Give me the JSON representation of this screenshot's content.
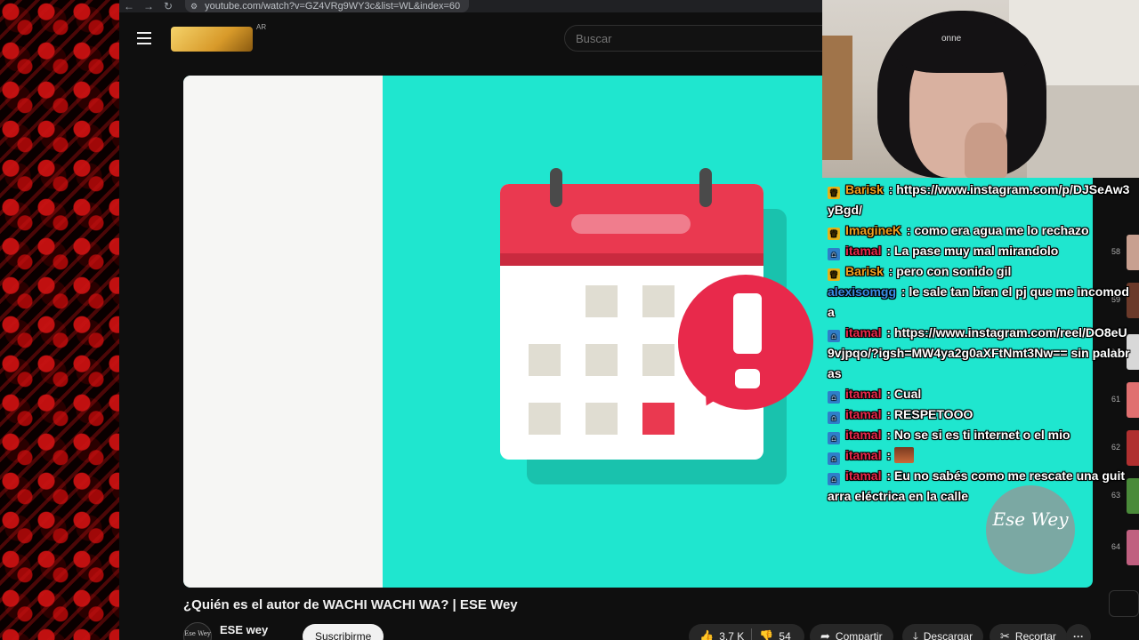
{
  "browser": {
    "back_icon": "arrow-left-icon",
    "forward_icon": "arrow-right-icon",
    "reload_icon": "reload-icon",
    "url": "youtube.com/watch?v=GZ4VRg9WY3c&list=WL&index=60"
  },
  "youtube": {
    "country_code": "AR",
    "search_placeholder": "Buscar"
  },
  "video": {
    "title": "¿Quién es el autor de WACHI WACHI WA? | ESE Wey",
    "channel": "ESE wey",
    "channel_avatar_text": "Ese Wey",
    "subscribe_label": "Suscribirme",
    "likes": "3,7 K",
    "dislikes": "54",
    "share_label": "Compartir",
    "download_label": "Descargar",
    "clip_label": "Recortar",
    "more_label": "···",
    "colors": {
      "background": "#1fe6cf",
      "calendar_red": "#ea3950",
      "alert_red": "#e8294b"
    }
  },
  "playlist": {
    "numbers": [
      "58",
      "59",
      "",
      "61",
      "62",
      "63",
      "64"
    ]
  },
  "webcam": {
    "brand_text": "onne"
  },
  "chat": {
    "messages": [
      {
        "badge": "crown",
        "user": "Barisk",
        "user_color": "#f0a020",
        "text": "https://www.instagram.com/p/DJSeAw3yBgd/",
        "emote": false
      },
      {
        "badge": "crown",
        "user": "ImagineK",
        "user_color": "#f0a020",
        "text": "como era agua me lo rechazo",
        "emote": false
      },
      {
        "badge": "prime",
        "user": "itamal",
        "user_color": "#e8294b",
        "text": "La pase muy mal mirandolo",
        "emote": false
      },
      {
        "badge": "crown",
        "user": "Barisk",
        "user_color": "#f0a020",
        "text": "pero con sonido gil",
        "emote": false
      },
      {
        "badge": "",
        "user": "alexisomgg",
        "user_color": "#3a8ee6",
        "text": "le sale tan bien el pj que me incomoda",
        "emote": false
      },
      {
        "badge": "prime",
        "user": "itamal",
        "user_color": "#e8294b",
        "text": "https://www.instagram.com/reel/DO8eU9vjpqo/?igsh=MW4ya2g0aXFtNmt3Nw== sin palabras",
        "emote": false
      },
      {
        "badge": "prime",
        "user": "itamal",
        "user_color": "#e8294b",
        "text": "Cual",
        "emote": false
      },
      {
        "badge": "prime",
        "user": "itamal",
        "user_color": "#e8294b",
        "text": "RESPETOOO",
        "emote": false
      },
      {
        "badge": "prime",
        "user": "itamal",
        "user_color": "#e8294b",
        "text": "No se si es ti internet o el mio",
        "emote": false
      },
      {
        "badge": "prime",
        "user": "itamal",
        "user_color": "#e8294b",
        "text": "",
        "emote": true
      },
      {
        "badge": "prime",
        "user": "itamal",
        "user_color": "#e8294b",
        "text": "Eu no sabés como me rescate una guitarra eléctrica en la calle",
        "emote": false
      }
    ],
    "watermark_text": "Ese Wey"
  }
}
